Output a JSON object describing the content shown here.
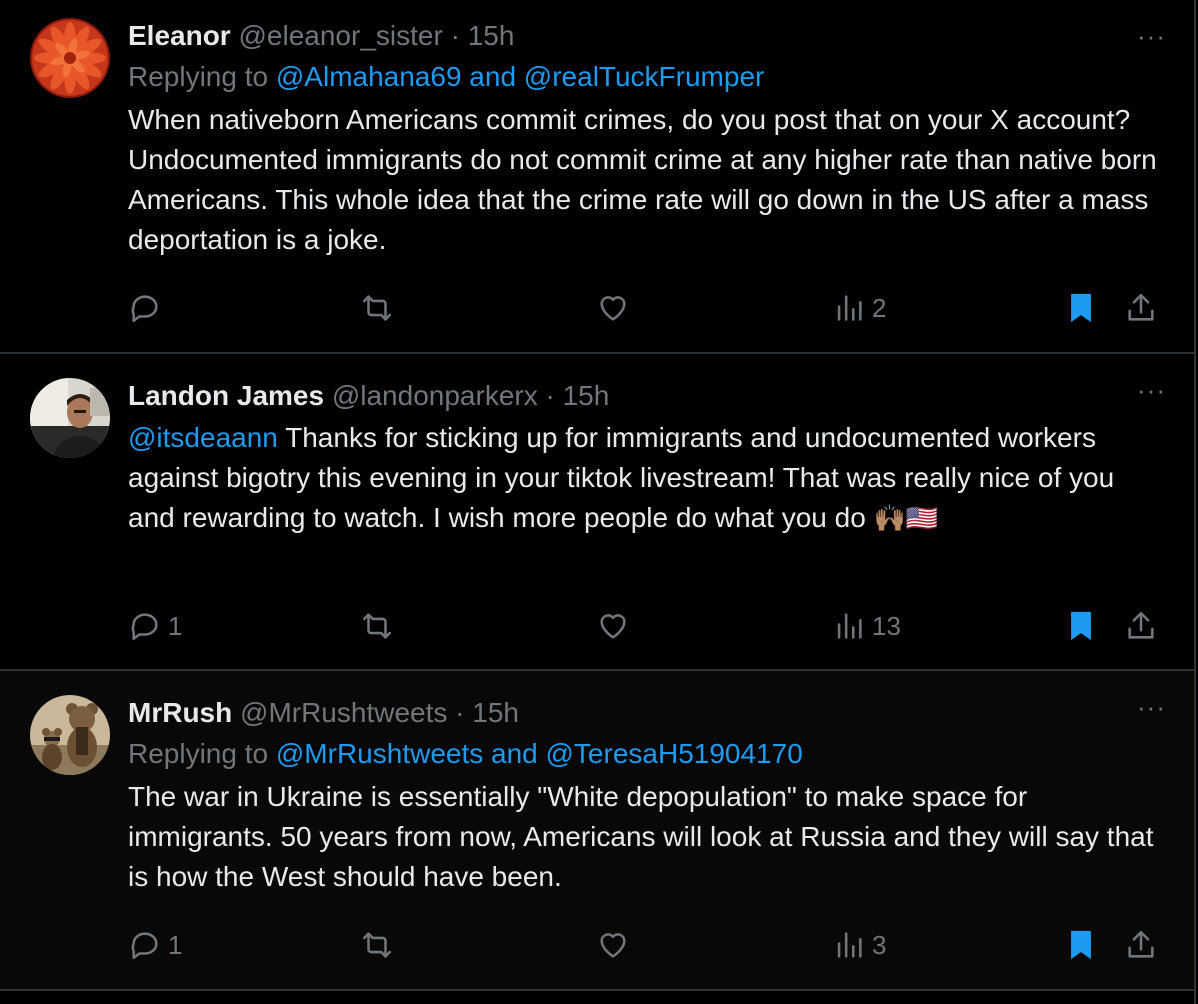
{
  "colors": {
    "background": "#000000",
    "text": "#e7e9ea",
    "secondary": "#71767b",
    "link": "#1d9bf0",
    "divider": "#2f3336",
    "bookmarked": "#1d9bf0"
  },
  "tweets": [
    {
      "name": "Eleanor",
      "handle": "@eleanor_sister",
      "separator": "·",
      "time": "15h",
      "replying_prefix": "Replying to",
      "replying_to": "@Almahana69 and @realTuckFrumper",
      "mention": "",
      "text": "When nativeborn Americans commit crimes, do you post that on your X account? Undocumented immigrants do not commit crime at any higher rate than native born Americans. This whole idea that the crime rate will go down in the US after a mass deportation is a joke.",
      "emoji": "",
      "replies": "",
      "reposts": "",
      "likes": "",
      "views": "2",
      "bookmarked": true,
      "more": "···",
      "avatar_icon": "orange-flower-avatar"
    },
    {
      "name": "Landon James",
      "handle": "@landonparkerx",
      "separator": "·",
      "time": "15h",
      "replying_prefix": "",
      "replying_to": "",
      "mention": "@itsdeaann",
      "text": " Thanks for sticking up for immigrants and undocumented workers against bigotry this evening in your tiktok livestream! That was really nice of you and rewarding to watch. I wish more people do what you do ",
      "emoji": "🙌🏽🇺🇸",
      "replies": "1",
      "reposts": "",
      "likes": "",
      "views": "13",
      "bookmarked": true,
      "more": "···",
      "avatar_icon": "man-in-car-avatar"
    },
    {
      "name": "MrRush",
      "handle": "@MrRushtweets",
      "separator": "·",
      "time": "15h",
      "replying_prefix": "Replying to",
      "replying_to": "@MrRushtweets and @TeresaH51904170",
      "mention": "",
      "text": "The war in Ukraine is essentially \"White depopulation\" to make space for immigrants. 50 years from now, Americans will look at Russia and they will say that is how the West should have been.",
      "emoji": "",
      "replies": "1",
      "reposts": "",
      "likes": "",
      "views": "3",
      "bookmarked": true,
      "more": "···",
      "avatar_icon": "teddy-bears-avatar"
    }
  ]
}
